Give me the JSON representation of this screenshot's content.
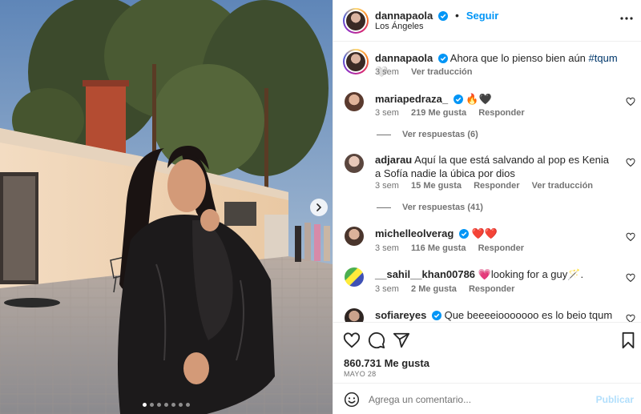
{
  "post": {
    "author": "dannapaola",
    "follow_label": "Seguir",
    "location": "Los Ángeles",
    "caption": {
      "username": "dannapaola",
      "text": "Ahora que lo pienso bien aún",
      "hashtag": "#tqum",
      "emoji": "🤍",
      "time": "3 sem",
      "translate_label": "Ver traducción"
    },
    "likes": "860.731 Me gusta",
    "date": "MAYO 28",
    "carousel": {
      "total": 7,
      "active_index": 0
    }
  },
  "comments": [
    {
      "username": "mariapedraza_",
      "verified": true,
      "text": "🔥🖤",
      "time": "3 sem",
      "likes": "219 Me gusta",
      "reply": "Responder",
      "translate": "",
      "view_replies": "Ver respuestas (6)"
    },
    {
      "username": "adjarau",
      "verified": false,
      "text": "Aquí la que está salvando al pop es Kenia a Sofía nadie la úbica por dios",
      "time": "3 sem",
      "likes": "15 Me gusta",
      "reply": "Responder",
      "translate": "Ver traducción",
      "view_replies": "Ver respuestas (41)"
    },
    {
      "username": "michelleolverag",
      "verified": true,
      "text": "❤️❤️",
      "time": "3 sem",
      "likes": "116 Me gusta",
      "reply": "Responder",
      "translate": "",
      "view_replies": ""
    },
    {
      "username": "__sahil__khan00786",
      "verified": false,
      "text": "💗looking for a guy🪄.",
      "time": "3 sem",
      "likes": "2 Me gusta",
      "reply": "Responder",
      "translate": "",
      "view_replies": ""
    },
    {
      "username": "sofiareyes",
      "verified": true,
      "text": "Que beeeeiooooooo es lo beio tqum",
      "time": "",
      "likes": "",
      "reply": "",
      "translate": "",
      "view_replies": ""
    }
  ],
  "add_comment": {
    "placeholder": "Agrega un comentario...",
    "publish_label": "Publicar"
  },
  "colors": {
    "link": "#0095f6",
    "verified": "#0095f6",
    "muted": "#737373",
    "text": "#262626",
    "publish_disabled": "#b2dffc"
  },
  "icons": [
    "more-icon",
    "verified-icon",
    "heart-icon",
    "comment-icon",
    "share-icon",
    "bookmark-icon",
    "emoji-icon",
    "chevron-right-icon"
  ]
}
